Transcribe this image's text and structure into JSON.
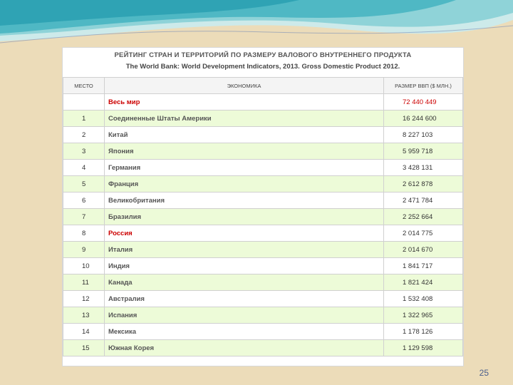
{
  "table": {
    "title": "РЕЙТИНГ СТРАН И ТЕРРИТОРИЙ ПО РАЗМЕРУ ВАЛОВОГО ВНУТРЕННЕГО ПРОДУКТА",
    "subtitle": "The World Bank: World Development Indicators, 2013. Gross Domestic Product 2012.",
    "headers": [
      "МЕСТО",
      "ЭКОНОМИКА",
      "РАЗМЕР ВВП ($ МЛН.)"
    ],
    "world_row": {
      "rank": "",
      "name": "Весь мир",
      "value": "72 440 449"
    },
    "rows": [
      {
        "rank": "1",
        "name": "Соединенные Штаты Америки",
        "value": "16 244 600"
      },
      {
        "rank": "2",
        "name": "Китай",
        "value": "8 227 103"
      },
      {
        "rank": "3",
        "name": "Япония",
        "value": "5 959 718"
      },
      {
        "rank": "4",
        "name": "Германия",
        "value": "3 428 131"
      },
      {
        "rank": "5",
        "name": "Франция",
        "value": "2 612 878"
      },
      {
        "rank": "6",
        "name": "Великобритания",
        "value": "2 471 784"
      },
      {
        "rank": "7",
        "name": "Бразилия",
        "value": "2 252 664"
      },
      {
        "rank": "8",
        "name": "Россия",
        "value": "2 014 775"
      },
      {
        "rank": "9",
        "name": "Италия",
        "value": "2 014 670"
      },
      {
        "rank": "10",
        "name": "Индия",
        "value": "1 841 717"
      },
      {
        "rank": "11",
        "name": "Канада",
        "value": "1 821 424"
      },
      {
        "rank": "12",
        "name": "Австралия",
        "value": "1 532 408"
      },
      {
        "rank": "13",
        "name": "Испания",
        "value": "1 322 965"
      },
      {
        "rank": "14",
        "name": "Мексика",
        "value": "1 178 126"
      },
      {
        "rank": "15",
        "name": "Южная Корея",
        "value": "1 129 598"
      }
    ]
  },
  "slide": {
    "page_number": "25"
  },
  "colors": {
    "background": "#ecdcb9",
    "wave_teal": "#4fb8c4",
    "highlight_red": "#cc0000",
    "row_green": "#edfbd8",
    "page_number": "#4a5f8c"
  }
}
